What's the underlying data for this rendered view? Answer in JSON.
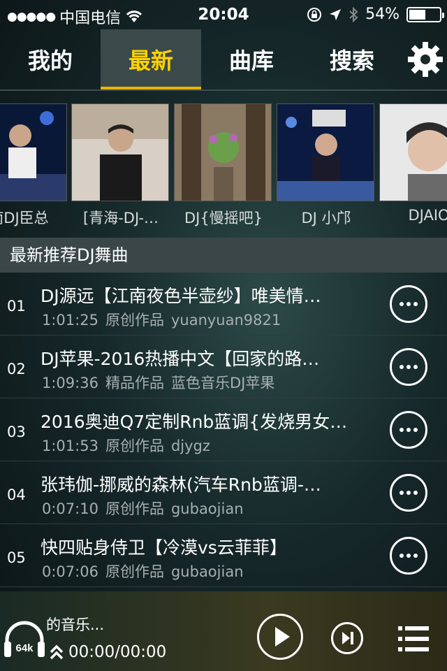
{
  "status": {
    "carrier": "中国电信",
    "time": "20:04",
    "battery": "54%",
    "battery_level": 0.54
  },
  "tabs": [
    {
      "label": "我的"
    },
    {
      "label": "最新"
    },
    {
      "label": "曲库"
    },
    {
      "label": "搜索"
    }
  ],
  "artists": [
    {
      "name": "南DJ臣总"
    },
    {
      "name": "[青海-DJ-…"
    },
    {
      "name": "DJ{慢摇吧}"
    },
    {
      "name": "DJ 小邝"
    },
    {
      "name": "DJAIO"
    }
  ],
  "section": {
    "title": "最新推荐DJ舞曲"
  },
  "tracks": [
    {
      "num": "01",
      "title": "DJ源远【江南夜色半壶纱】唯美情…",
      "duration": "1:01:25",
      "category": "原创作品",
      "author": "yuanyuan9821"
    },
    {
      "num": "02",
      "title": "DJ苹果-2016热播中文【回家的路…",
      "duration": "1:09:36",
      "category": "精品作品",
      "author": "蓝色音乐DJ苹果"
    },
    {
      "num": "03",
      "title": "2016奥迪Q7定制Rnb蓝调{发烧男女…",
      "duration": "1:01:53",
      "category": "原创作品",
      "author": "djygz"
    },
    {
      "num": "04",
      "title": "张玮伽-挪威的森林(汽车Rnb蓝调-…",
      "duration": "0:07:10",
      "category": "原创作品",
      "author": "gubaojian"
    },
    {
      "num": "05",
      "title": "快四贴身侍卫【冷漠vs云菲菲】",
      "duration": "0:07:06",
      "category": "原创作品",
      "author": "gubaojian"
    }
  ],
  "player": {
    "title": "的音乐...",
    "time": "00:00/00:00",
    "quality": "64k"
  },
  "colors": {
    "accent": "#ffd200",
    "tab_active_bg": "#3a4a4b"
  }
}
